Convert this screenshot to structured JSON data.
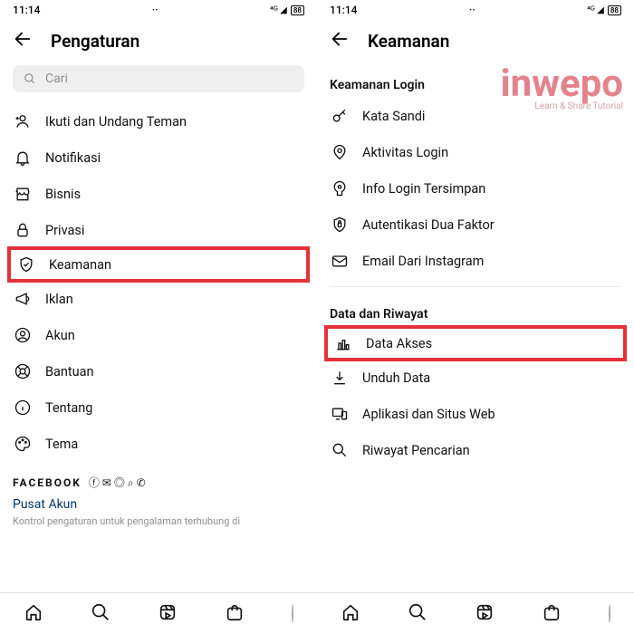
{
  "status": {
    "time": "11:14",
    "battery": "88"
  },
  "left": {
    "title": "Pengaturan",
    "search_placeholder": "Cari",
    "items": [
      {
        "id": "invite",
        "label": "Ikuti dan Undang Teman"
      },
      {
        "id": "notif",
        "label": "Notifikasi"
      },
      {
        "id": "business",
        "label": "Bisnis"
      },
      {
        "id": "privacy",
        "label": "Privasi"
      },
      {
        "id": "security",
        "label": "Keamanan",
        "highlight": true
      },
      {
        "id": "ads",
        "label": "Iklan"
      },
      {
        "id": "account",
        "label": "Akun"
      },
      {
        "id": "help",
        "label": "Bantuan"
      },
      {
        "id": "about",
        "label": "Tentang"
      },
      {
        "id": "theme",
        "label": "Tema"
      }
    ],
    "fb_label": "FACEBOOK",
    "accounts_center": "Pusat Akun",
    "footnote": "Kontrol pengaturan untuk pengalaman terhubung di"
  },
  "right": {
    "title": "Keamanan",
    "sections": [
      {
        "title": "Keamanan Login",
        "items": [
          {
            "id": "password",
            "label": "Kata Sandi"
          },
          {
            "id": "login-activity",
            "label": "Aktivitas Login"
          },
          {
            "id": "saved-login",
            "label": "Info Login Tersimpan"
          },
          {
            "id": "2fa",
            "label": "Autentikasi Dua Faktor"
          },
          {
            "id": "emails",
            "label": "Email Dari Instagram"
          }
        ]
      },
      {
        "title": "Data dan Riwayat",
        "items": [
          {
            "id": "data-access",
            "label": "Data Akses",
            "highlight": true
          },
          {
            "id": "download",
            "label": "Unduh Data"
          },
          {
            "id": "apps-web",
            "label": "Aplikasi dan Situs Web"
          },
          {
            "id": "search-history",
            "label": "Riwayat Pencarian"
          }
        ]
      }
    ]
  },
  "watermark": {
    "big": "inwepo",
    "small": "Learn & Share Tutorial"
  }
}
